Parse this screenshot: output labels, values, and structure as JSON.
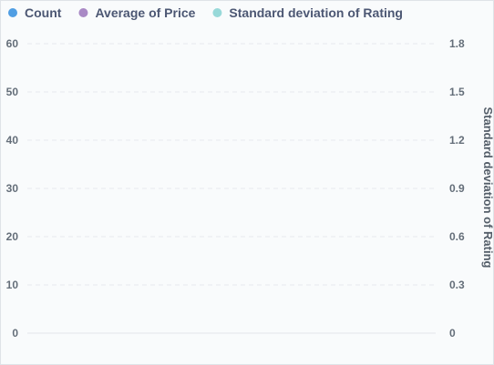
{
  "chart_data": {
    "type": "line",
    "title": "",
    "xlabel": "",
    "ylabel_left": "",
    "ylabel_right": "Standard deviation of Rating",
    "legend": {
      "placement": "top-left",
      "entries": [
        {
          "name": "Count",
          "color": "#509ee3"
        },
        {
          "name": "Average of Price",
          "color": "#a989c5"
        },
        {
          "name": "Standard deviation of Rating",
          "color": "#98d9d9"
        }
      ]
    },
    "y_left": {
      "ticks": [
        "60",
        "50",
        "40",
        "30",
        "20",
        "10",
        "0"
      ],
      "ylim": [
        0,
        60
      ]
    },
    "y_right": {
      "ticks": [
        "1.8",
        "1.5",
        "1.2",
        "0.9",
        "0.6",
        "0.3",
        "0"
      ],
      "ylim": [
        0,
        1.8
      ]
    },
    "grid": true,
    "series": [
      {
        "name": "Count",
        "values": []
      },
      {
        "name": "Average of Price",
        "values": []
      },
      {
        "name": "Standard deviation of Rating",
        "values": []
      }
    ]
  },
  "colors": {
    "grid": "#e7eaee",
    "axis_text": "#646e79",
    "right_label": "#545e69",
    "legend_text": "#4c5773"
  }
}
